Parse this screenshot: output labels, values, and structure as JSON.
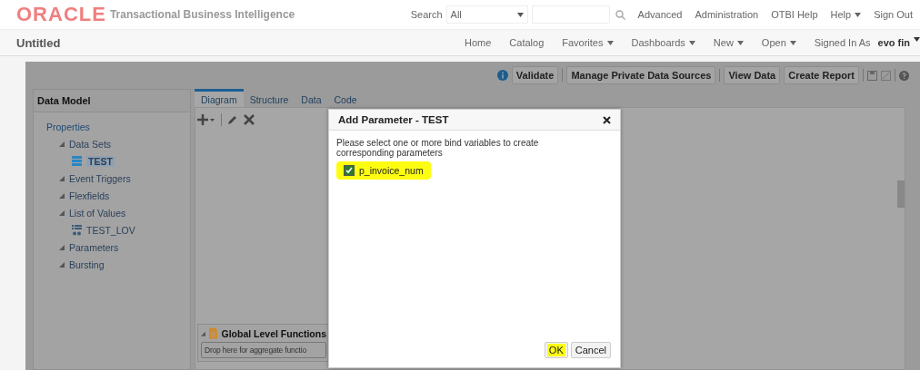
{
  "header": {
    "logo": "ORACLE",
    "product": "Transactional Business Intelligence",
    "search_label": "Search",
    "search_scope": "All",
    "links": [
      {
        "label": "Advanced",
        "kind": "link"
      },
      {
        "label": "Administration",
        "kind": "link"
      },
      {
        "label": "OTBI Help",
        "kind": "link"
      },
      {
        "label": "Help",
        "kind": "menu"
      },
      {
        "label": "Sign Out",
        "kind": "link"
      }
    ]
  },
  "page": {
    "title": "Untitled",
    "nav": [
      {
        "label": "Home",
        "kind": "link"
      },
      {
        "label": "Catalog",
        "kind": "link"
      },
      {
        "label": "Favorites",
        "kind": "menu"
      },
      {
        "label": "Dashboards",
        "kind": "menu"
      },
      {
        "label": "New",
        "kind": "menu"
      },
      {
        "label": "Open",
        "kind": "menu"
      }
    ],
    "signed_in_label": "Signed In As",
    "user": "evo fin"
  },
  "toolbar": {
    "buttons": [
      "Validate",
      "Manage Private Data Sources",
      "View Data",
      "Create Report"
    ]
  },
  "data_model": {
    "title": "Data Model",
    "tree": [
      {
        "label": "Properties",
        "kind": "link",
        "children": [
          {
            "label": "Data Sets",
            "kind": "folder",
            "children": [
              {
                "label": "TEST",
                "kind": "dataset",
                "selected": true
              }
            ]
          },
          {
            "label": "Event Triggers",
            "kind": "folder"
          },
          {
            "label": "Flexfields",
            "kind": "folder"
          },
          {
            "label": "List of Values",
            "kind": "folder",
            "children": [
              {
                "label": "TEST_LOV",
                "kind": "lov",
                "selected": false
              }
            ]
          },
          {
            "label": "Parameters",
            "kind": "folder"
          },
          {
            "label": "Bursting",
            "kind": "folder"
          }
        ]
      }
    ]
  },
  "tabs": [
    {
      "label": "Diagram",
      "selected": true
    },
    {
      "label": "Structure",
      "selected": false
    },
    {
      "label": "Data",
      "selected": false
    },
    {
      "label": "Code",
      "selected": false
    }
  ],
  "global_functions": {
    "title": "Global Level Functions",
    "drop_hint": "Drop here for aggregate functio"
  },
  "dialog": {
    "title": "Add Parameter - TEST",
    "message": "Please select one or more bind variables to create corresponding parameters",
    "params": [
      {
        "label": "p_invoice_num",
        "checked": true,
        "highlighted": true
      }
    ],
    "buttons": [
      {
        "label": "OK",
        "highlighted": true
      },
      {
        "label": "Cancel",
        "highlighted": false
      }
    ]
  }
}
